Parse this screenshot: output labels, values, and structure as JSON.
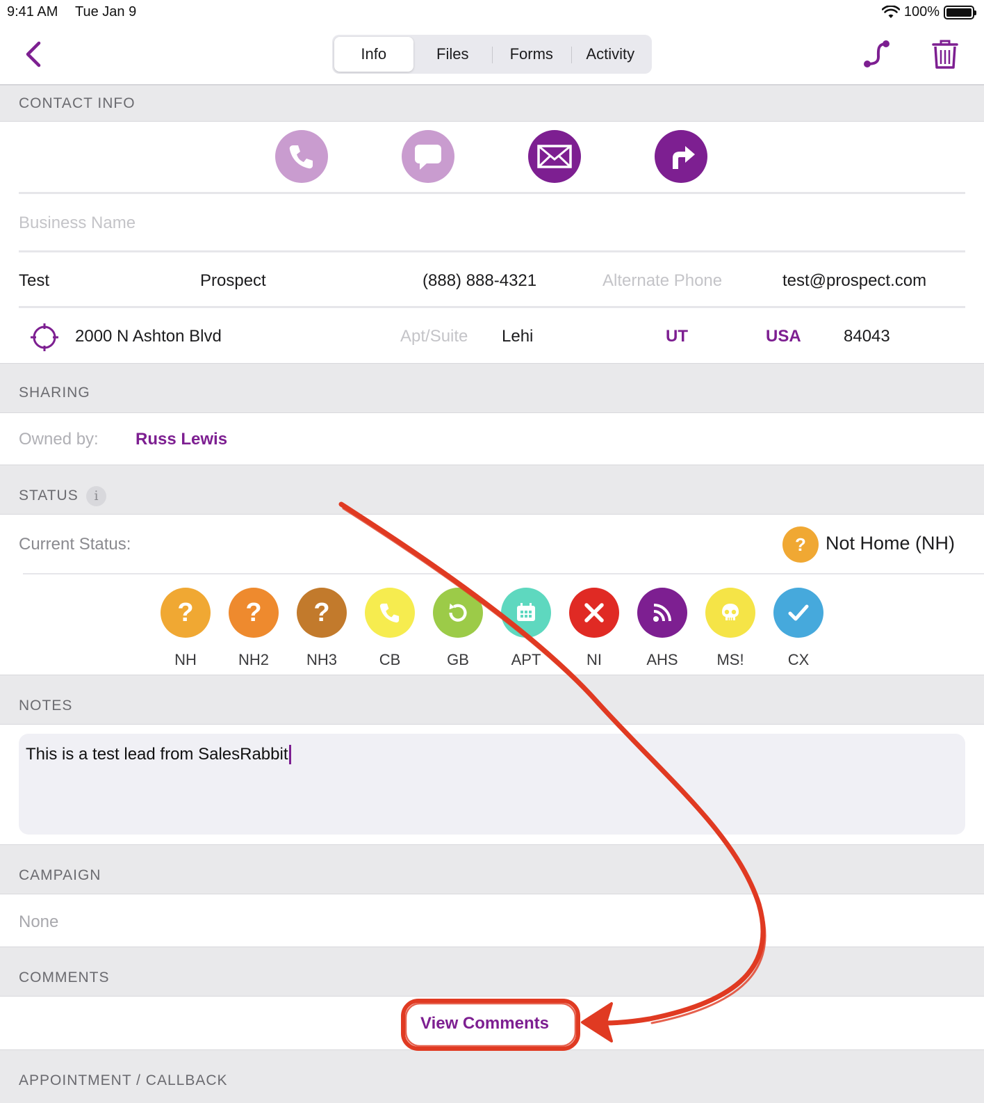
{
  "status_bar": {
    "time": "9:41 AM",
    "date": "Tue Jan 9",
    "battery": "100%"
  },
  "nav": {
    "tabs": [
      {
        "label": "Info",
        "active": true
      },
      {
        "label": "Files"
      },
      {
        "label": "Forms"
      },
      {
        "label": "Activity"
      }
    ]
  },
  "contact_info": {
    "header": "CONTACT INFO",
    "actions": [
      {
        "name": "phone-icon",
        "color": "#c99ccf"
      },
      {
        "name": "message-icon",
        "color": "#c99ccf"
      },
      {
        "name": "mail-icon",
        "color": "#7d1f91"
      },
      {
        "name": "directions-icon",
        "color": "#7d1f91"
      }
    ],
    "business_name_placeholder": "Business Name",
    "first_name": "Test",
    "last_name": "Prospect",
    "phone": "(888) 888-4321",
    "alt_phone_placeholder": "Alternate Phone",
    "email": "test@prospect.com",
    "street": "2000 N Ashton Blvd",
    "apt_placeholder": "Apt/Suite",
    "city": "Lehi",
    "state": "UT",
    "country": "USA",
    "zip": "84043"
  },
  "sharing": {
    "header": "SHARING",
    "owned_label": "Owned by:",
    "owner": "Russ Lewis"
  },
  "status": {
    "header": "STATUS",
    "current_label": "Current Status:",
    "current_value": "Not Home (NH)",
    "options": [
      {
        "code": "NH",
        "color": "#f0a833",
        "icon": "question-icon"
      },
      {
        "code": "NH2",
        "color": "#ee8a2e",
        "icon": "question-icon"
      },
      {
        "code": "NH3",
        "color": "#c27a2c",
        "icon": "question-icon"
      },
      {
        "code": "CB",
        "color": "#f6ec4f",
        "icon": "phone-icon"
      },
      {
        "code": "GB",
        "color": "#9ccb48",
        "icon": "refresh-icon"
      },
      {
        "code": "APT",
        "color": "#5ed8bf",
        "icon": "calendar-icon"
      },
      {
        "code": "NI",
        "color": "#e02a24",
        "icon": "close-icon"
      },
      {
        "code": "AHS",
        "color": "#7d1f91",
        "icon": "rss-icon"
      },
      {
        "code": "MS!",
        "color": "#f5e447",
        "icon": "skull-icon"
      },
      {
        "code": "CX",
        "color": "#46a9dc",
        "icon": "check-icon"
      }
    ]
  },
  "notes": {
    "header": "NOTES",
    "text": "This is a test lead from SalesRabbit"
  },
  "campaign": {
    "header": "CAMPAIGN",
    "value": "None"
  },
  "comments": {
    "header": "COMMENTS",
    "button": "View Comments"
  },
  "appointment": {
    "header": "APPOINTMENT / CALLBACK"
  },
  "colors": {
    "accent": "#7d1f91",
    "annotation": "#e03a22"
  }
}
